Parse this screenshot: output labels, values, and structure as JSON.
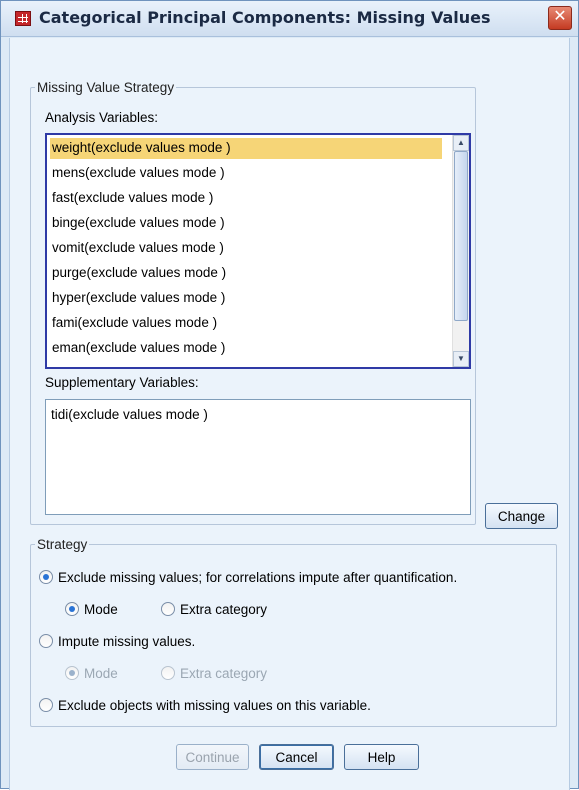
{
  "window": {
    "title": "Categorical Principal Components: Missing Values",
    "close_symbol": "✕"
  },
  "missing_value_strategy": {
    "legend": "Missing Value Strategy",
    "analysis_label": "Analysis Variables:",
    "analysis_items": [
      "weight(exclude values mode )",
      "mens(exclude values mode )",
      "fast(exclude values mode )",
      "binge(exclude values mode )",
      "vomit(exclude values mode )",
      "purge(exclude values mode )",
      "hyper(exclude values mode )",
      "fami(exclude values mode )",
      "eman(exclude values mode )"
    ],
    "selected_index": 0,
    "supplementary_label": "Supplementary Variables:",
    "supplementary_items": [
      "tidi(exclude values mode )"
    ],
    "scroll_up": "▲",
    "scroll_down": "▼"
  },
  "change_button": "Change",
  "strategy": {
    "legend": "Strategy",
    "exclude_label": "Exclude missing values; for correlations impute after quantification.",
    "exclude_mode": "Mode",
    "exclude_extra": "Extra category",
    "impute_label": "Impute missing values.",
    "impute_mode": "Mode",
    "impute_extra": "Extra category",
    "exclude_objects_label": "Exclude objects with missing values on this variable."
  },
  "footer": {
    "continue": "Continue",
    "cancel": "Cancel",
    "help": "Help"
  },
  "colors": {
    "selection": "#f6d577",
    "listbox_border": "#2f3aa6",
    "dialog_bg": "#ebf3fb"
  }
}
